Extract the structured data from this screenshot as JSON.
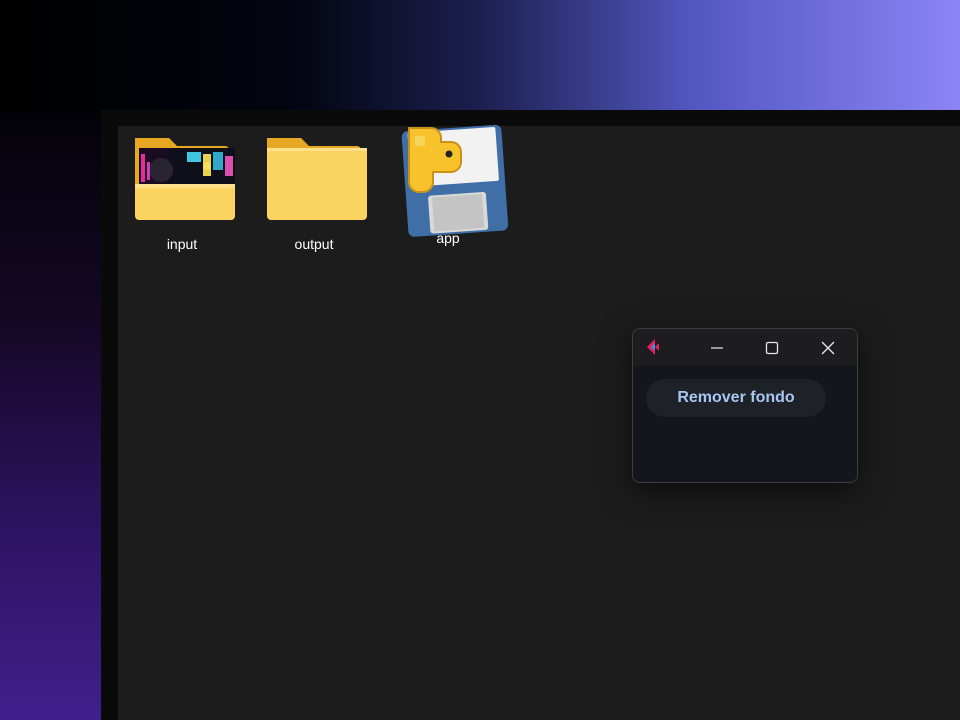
{
  "desktop": {
    "items": [
      {
        "label": "input",
        "icon": "folder-with-image-icon"
      },
      {
        "label": "output",
        "icon": "folder-icon"
      },
      {
        "label": "app",
        "icon": "python-file-icon"
      }
    ]
  },
  "app_window": {
    "logo": "flet-logo-icon",
    "controls": {
      "minimize": "minimize-icon",
      "maximize": "maximize-icon",
      "close": "close-icon"
    },
    "button_label": "Remover fondo"
  },
  "colors": {
    "folder": "#f8c94a",
    "accent_text": "#a7c7f2",
    "window_bg": "#13161b"
  }
}
